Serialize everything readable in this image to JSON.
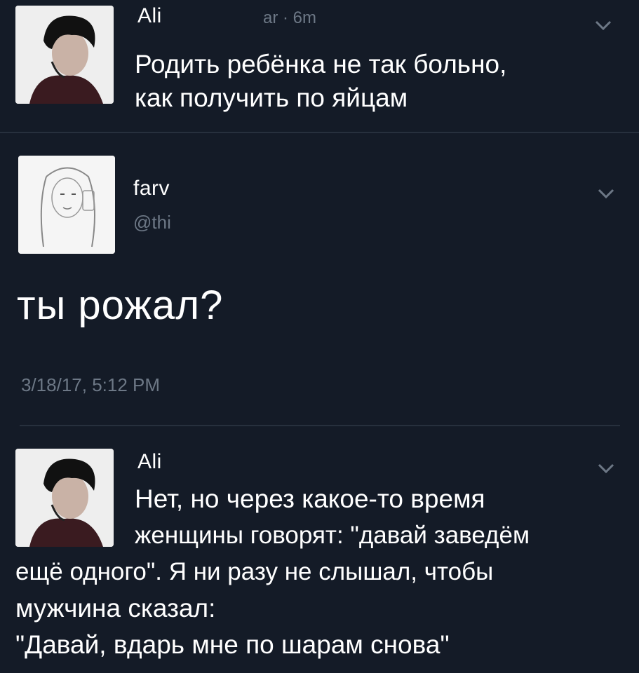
{
  "tweet1": {
    "author": "Ali",
    "meta": "ar · 6m",
    "lines": [
      "Родить ребёнка не так больно,",
      "как получить по яйцам"
    ]
  },
  "tweet2": {
    "author": "farv",
    "handle": "@thi",
    "text": "ты рожал?",
    "timestamp": "3/18/17, 5:12 PM"
  },
  "tweet3": {
    "author": "Ali",
    "lines": [
      "Нет, но через какое-то время",
      "женщины говорят: \"давай заведём",
      "ещё одного\". Я ни разу не слышал, чтобы",
      "мужчина сказал:",
      "\"Давай, вдарь мне по шарам снова\""
    ]
  },
  "icons": {
    "more": "chevron-down-icon"
  },
  "colors": {
    "background": "#141b27",
    "secondary_text": "#6d7886",
    "divider": "#27303d"
  }
}
